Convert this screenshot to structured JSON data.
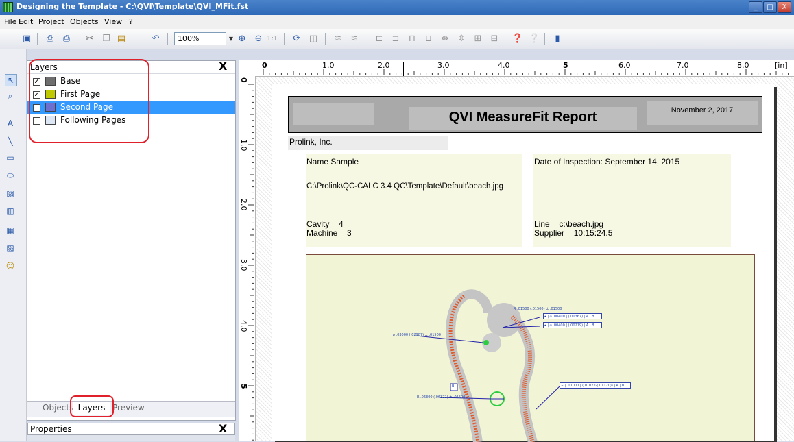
{
  "window": {
    "title": "Designing the Template - C:\\QVI\\Template\\QVI_MFit.fst",
    "controls": [
      "_",
      "□",
      "X"
    ]
  },
  "menu": [
    "File",
    "Edit",
    "Project",
    "Objects",
    "View",
    "?"
  ],
  "toolbar": {
    "zoom": "100%",
    "one_to_one": "1:1"
  },
  "layers_panel": {
    "title": "Layers",
    "close": "X",
    "layers": [
      {
        "label": "Base",
        "checked": true,
        "color": "#6e6e6e",
        "selected": false
      },
      {
        "label": "First Page",
        "checked": true,
        "color": "#c0c800",
        "selected": false
      },
      {
        "label": "Second Page",
        "checked": false,
        "color": "#6a6fd0",
        "selected": true
      },
      {
        "label": "Following Pages",
        "checked": false,
        "color": "#dce6f5",
        "selected": false
      }
    ],
    "tabs": [
      "Objects",
      "Layers",
      "Preview"
    ],
    "active_tab": "Layers"
  },
  "properties_panel": {
    "title": "Properties",
    "close": "X"
  },
  "ruler": {
    "unit": "[in]",
    "h_labels": [
      "0",
      "1.0",
      "2.0",
      "3.0",
      "4.0",
      "5",
      "6.0",
      "7.0",
      "8.0"
    ],
    "v_labels": [
      "0",
      "1.0",
      "2.0",
      "3.0",
      "4.0",
      "5"
    ]
  },
  "report": {
    "title": "QVI MeasureFit Report",
    "date": "November 2, 2017",
    "company": "Prolink, Inc.",
    "left_info": {
      "name": "Name Sample",
      "path": "C:\\Prolink\\QC-CALC 3.4 QC\\Template\\Default\\beach.jpg",
      "cavity": "Cavity = 4",
      "machine": "Machine = 3"
    },
    "right_info": {
      "date": "Date of Inspection: September 14, 2015",
      "line": "Line = c:\\beach.jpg",
      "supplier": "Supplier = 10:15:24.5"
    }
  },
  "drawing_annotations": {
    "a1": "R .01500 (.01500) ± .01500",
    "a2": "⌀ .03000 (.02987) ± .01500",
    "a3": "R .06300 (.06322) ± .01500",
    "fcf1": "⌖ | ⌀ .00400 | (.00367) | A | B",
    "fcf2": "⌖ | ⌀ .00400 | (.00219) | A | B",
    "fcf3": "⌓ | .01000 | (.01072-(.01120)) | A | B",
    "datum": "B"
  },
  "colors": {
    "highlight": "#e0202a",
    "selected_row": "#3399ff",
    "titlebar": "#3a75c0"
  }
}
